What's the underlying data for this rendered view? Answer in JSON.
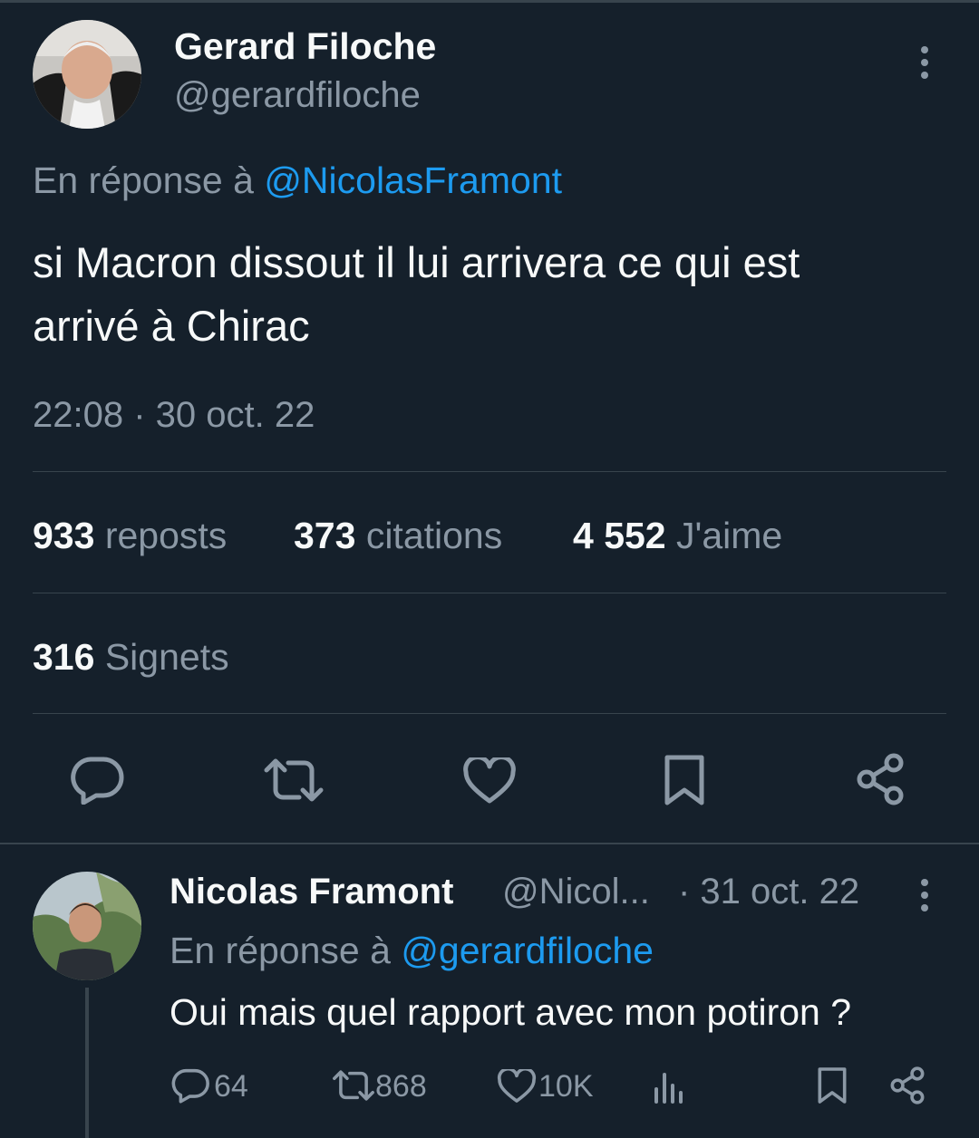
{
  "tweet": {
    "author_name": "Gerard Filoche",
    "author_handle": "@gerardfiloche",
    "reply_prefix": "En réponse à",
    "reply_to": "@NicolasFramont",
    "text_line1": "si Macron dissout il lui arrivera ce qui est",
    "text_line2": "arrivé à Chirac",
    "timestamp": "22:08 · 30 oct. 22",
    "stats": {
      "reposts_count": "933",
      "reposts_label": "reposts",
      "quotes_count": "373",
      "quotes_label": "citations",
      "likes_count": "4 552",
      "likes_label": "J'aime",
      "bookmarks_count": "316",
      "bookmarks_label": "Signets"
    }
  },
  "reply": {
    "author_name": "Nicolas Framont",
    "author_handle": "@Nicol...",
    "date": "· 31 oct. 22",
    "reply_prefix": "En réponse à",
    "reply_to": "@gerardfiloche",
    "text": "Oui mais quel rapport avec mon potiron ?",
    "counts": {
      "replies": "64",
      "reposts": "868",
      "likes": "10K"
    }
  },
  "colors": {
    "background": "#15202b",
    "text": "#f7f9f9",
    "muted": "#8b98a5",
    "link": "#1d9bf0",
    "divider": "#38444d"
  }
}
